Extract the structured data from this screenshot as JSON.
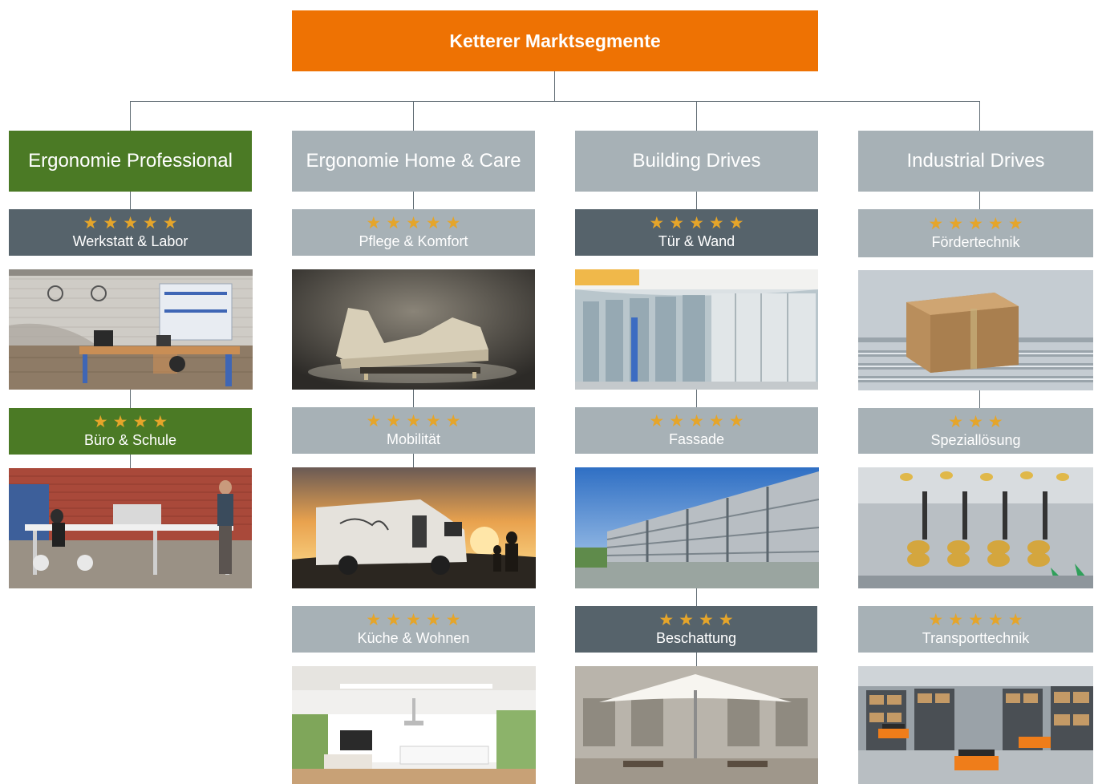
{
  "root": {
    "title": "Ketterer Marktsegmente",
    "color": "#ee7203"
  },
  "colors": {
    "active": "#4b7a25",
    "light": "#a7b1b6",
    "dark": "#56636b",
    "star": "#e5a52a"
  },
  "segments": [
    {
      "label": "Ergonomie Professional",
      "active": true,
      "items": [
        {
          "stars": "★★★★★",
          "rating": 5,
          "label": "Werkstatt & Labor",
          "tone": "dark",
          "photo": "workshop-lab-photo"
        },
        {
          "stars": "★★★★",
          "rating": 4,
          "label": "Büro & Schule",
          "tone": "active",
          "photo": "office-school-photo"
        }
      ]
    },
    {
      "label": "Ergonomie Home & Care",
      "active": false,
      "items": [
        {
          "stars": "★★★★★",
          "rating": 5,
          "label": "Pflege & Komfort",
          "tone": "light",
          "photo": "care-bed-photo"
        },
        {
          "stars": "★★★★★",
          "rating": 5,
          "label": "Mobilität",
          "tone": "light",
          "photo": "camper-van-photo"
        },
        {
          "stars": "★★★★★",
          "rating": 5,
          "label": "Küche & Wohnen",
          "tone": "light",
          "photo": "kitchen-living-photo"
        }
      ]
    },
    {
      "label": "Building Drives",
      "active": false,
      "items": [
        {
          "stars": "★★★★★",
          "rating": 5,
          "label": "Tür & Wand",
          "tone": "dark",
          "photo": "glass-door-photo"
        },
        {
          "stars": "★★★★★",
          "rating": 5,
          "label": "Fassade",
          "tone": "light",
          "photo": "facade-photo"
        },
        {
          "stars": "★★★★",
          "rating": 4,
          "label": "Beschattung",
          "tone": "dark",
          "photo": "parasol-shading-photo"
        }
      ]
    },
    {
      "label": "Industrial Drives",
      "active": false,
      "items": [
        {
          "stars": "★★★★★",
          "rating": 5,
          "label": "Fördertechnik",
          "tone": "light",
          "photo": "conveyor-box-photo"
        },
        {
          "stars": "★★★",
          "rating": 3,
          "label": "Speziallösung",
          "tone": "light",
          "photo": "biscuit-line-photo"
        },
        {
          "stars": "★★★★★",
          "rating": 5,
          "label": "Transporttechnik",
          "tone": "light",
          "photo": "warehouse-robots-photo"
        }
      ]
    }
  ]
}
